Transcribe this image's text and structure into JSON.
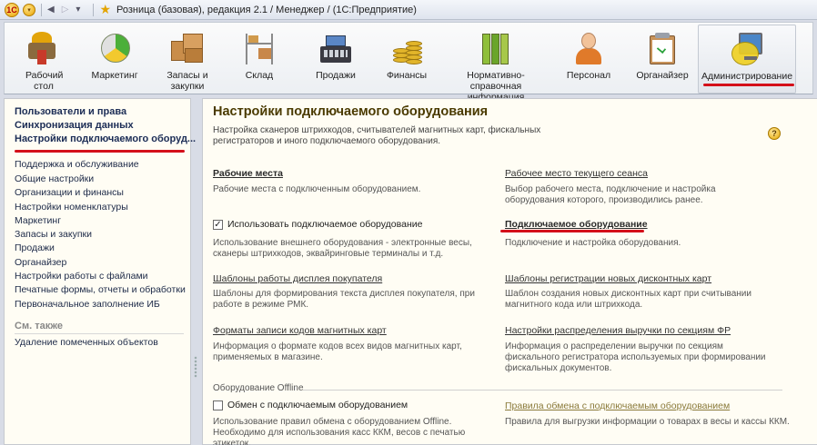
{
  "titlebar": {
    "title": "Розница (базовая), редакция 2.1 / Менеджер /  (1С:Предприятие)",
    "logo": "1C",
    "menu_arrow": "▾",
    "back": "◀",
    "forward": "▷",
    "nav_dropdown": "▾",
    "favorite": "★"
  },
  "sections": [
    {
      "label": "Рабочий стол",
      "icon": "home-icon"
    },
    {
      "label": "Маркетинг",
      "icon": "pie-chart-icon"
    },
    {
      "label": "Запасы и закупки",
      "icon": "boxes-icon"
    },
    {
      "label": "Склад",
      "icon": "shelves-icon"
    },
    {
      "label": "Продажи",
      "icon": "cash-register-icon"
    },
    {
      "label": "Финансы",
      "icon": "coins-icon"
    },
    {
      "label": "Нормативно-справочная информация",
      "icon": "binders-icon"
    },
    {
      "label": "Персонал",
      "icon": "person-icon"
    },
    {
      "label": "Органайзер",
      "icon": "clipboard-icon"
    },
    {
      "label": "Администрирование",
      "icon": "admin-icon"
    }
  ],
  "active_section": "Администрирование",
  "left_panel": {
    "bold_items": [
      "Пользователи и права",
      "Синхронизация данных",
      "Настройки подключаемого оборуд..."
    ],
    "items": [
      "Поддержка и обслуживание",
      "Общие настройки",
      "Организации и финансы",
      "Настройки номенклатуры",
      "Маркетинг",
      "Запасы и закупки",
      "Продажи",
      "Органайзер",
      "Настройки работы с файлами",
      "Печатные формы, отчеты и обработки",
      "Первоначальное заполнение ИБ"
    ],
    "group_title": "См. также",
    "see_also": [
      "Удаление помеченных объектов"
    ]
  },
  "main": {
    "title": "Настройки подключаемого оборудования",
    "description": "Настройка сканеров штрихкодов, считывателей магнитных карт, фискальных регистраторов и иного подключаемого оборудования.",
    "help": "?",
    "workplaces_link": "Рабочие места",
    "workplaces_desc": "Рабочие места с подключенным оборудованием.",
    "current_workplace_link": "Рабочее место текущего сеанса",
    "current_workplace_desc": "Выбор рабочего места, подключение и настройка оборудования которого, производились ранее.",
    "use_equipment_label": "Использовать подключаемое оборудование",
    "use_equipment_checked": true,
    "use_equipment_desc": "Использование внешнего оборудования - электронные весы, сканеры штрихкодов, эквайринговые терминалы и т.д.",
    "connected_equipment_link": "Подключаемое оборудование",
    "connected_equipment_desc": "Подключение и настройка оборудования.",
    "display_templates_link": "Шаблоны работы дисплея покупателя",
    "display_templates_desc": "Шаблоны для формирования текста дисплея покупателя, при работе в режиме РМК.",
    "discount_templates_link": "Шаблоны регистрации новых дисконтных карт",
    "discount_templates_desc": "Шаблон создания новых дисконтных карт при считывании магнитного кода или штрихкода.",
    "card_formats_link": "Форматы записи кодов магнитных карт",
    "card_formats_desc": "Информация о формате кодов всех видов магнитных карт, применяемых в магазине.",
    "revenue_link": "Настройки распределения выручки по секциям ФР",
    "revenue_desc": "Информация о распределении выручки по секциям фискального регистратора используемых при формировании фискальных документов.",
    "offline_group": "Оборудование Offline",
    "offline_exchange_label": "Обмен с подключаемым оборудованием",
    "offline_exchange_checked": false,
    "offline_exchange_desc": "Использование правил обмена с оборудованием Offline. Необходимо для использования касс ККМ, весов с печатью этикеток.",
    "exchange_rules_link": "Правила обмена с подключаемым оборудованием",
    "exchange_rules_desc": "Правила для выгрузки информации о товарах в весы и кассы ККМ."
  },
  "colors": {
    "highlight": "#d4101a",
    "panel_bg": "#fffdf4",
    "title": "#4a3a00"
  }
}
